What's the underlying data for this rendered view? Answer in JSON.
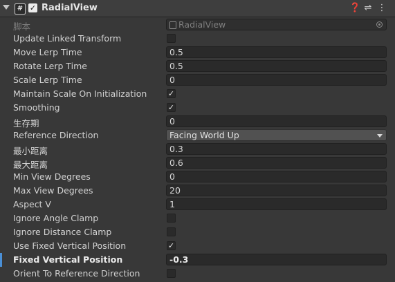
{
  "component": {
    "title": "RadialView",
    "enabled": true,
    "icons": {
      "help": "help-icon",
      "presets": "presets-icon",
      "menu": "more-menu-icon"
    }
  },
  "rows": {
    "script": {
      "label": "脚本",
      "value": "RadialView"
    },
    "update_linked_transform": {
      "label": "Update Linked Transform",
      "checked": false
    },
    "move_lerp_time": {
      "label": "Move Lerp Time",
      "value": "0.5"
    },
    "rotate_lerp_time": {
      "label": "Rotate Lerp Time",
      "value": "0.5"
    },
    "scale_lerp_time": {
      "label": "Scale Lerp Time",
      "value": "0"
    },
    "maintain_scale": {
      "label": "Maintain Scale On Initialization",
      "checked": true
    },
    "smoothing": {
      "label": "Smoothing",
      "checked": true
    },
    "lifetime": {
      "label": "生存期",
      "value": "0"
    },
    "reference_direction": {
      "label": "Reference Direction",
      "value": "Facing World Up"
    },
    "min_distance": {
      "label": "最小距离",
      "value": "0.3"
    },
    "max_distance": {
      "label": "最大距离",
      "value": "0.6"
    },
    "min_view_degrees": {
      "label": "Min View Degrees",
      "value": "0"
    },
    "max_view_degrees": {
      "label": "Max View Degrees",
      "value": "20"
    },
    "aspect_v": {
      "label": "Aspect V",
      "value": "1"
    },
    "ignore_angle_clamp": {
      "label": "Ignore Angle Clamp",
      "checked": false
    },
    "ignore_distance_clamp": {
      "label": "Ignore Distance Clamp",
      "checked": false
    },
    "use_fixed_vertical_position": {
      "label": "Use Fixed Vertical Position",
      "checked": true
    },
    "fixed_vertical_position": {
      "label": "Fixed Vertical Position",
      "value": "-0.3"
    },
    "orient_to_reference_direction": {
      "label": "Orient To Reference Direction",
      "checked": false
    }
  },
  "colors": {
    "accent": "#4a8fd6",
    "background": "#383838",
    "field": "#2a2a2a"
  }
}
